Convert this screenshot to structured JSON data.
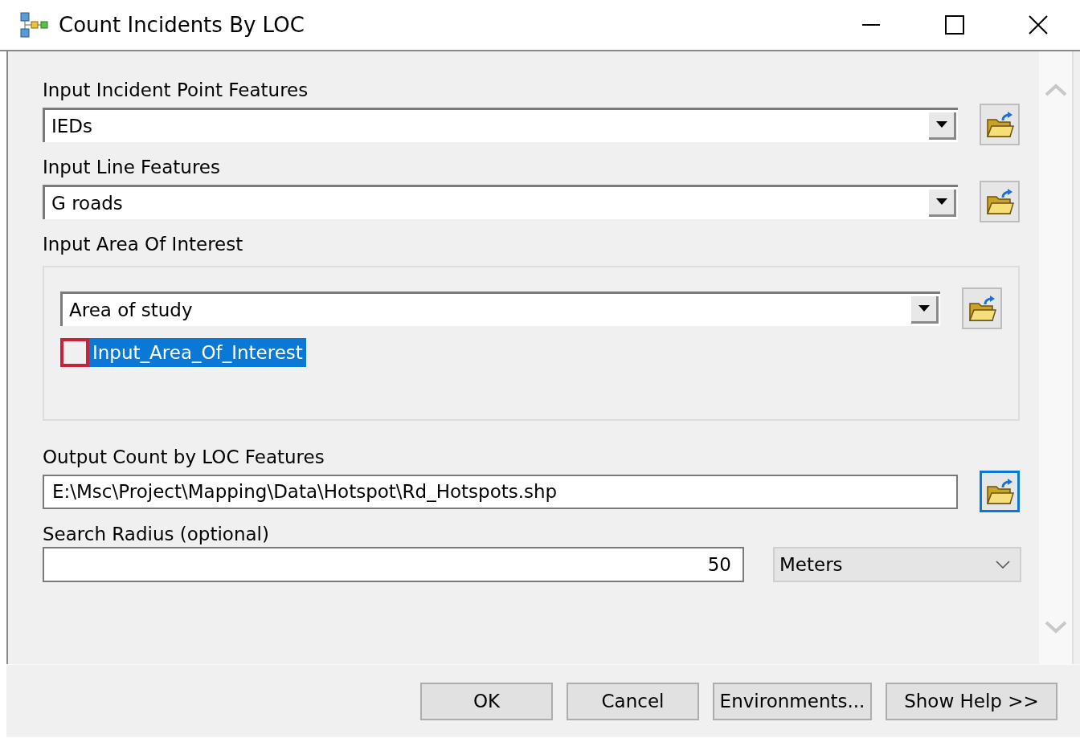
{
  "window": {
    "title": "Count Incidents By LOC"
  },
  "parameters": [
    {
      "kind": "combo",
      "label": "Input Incident Point Features",
      "value": "IEDs",
      "browse_focused": false
    },
    {
      "kind": "combo",
      "label": "Input Line Features",
      "value": "G roads",
      "browse_focused": false
    },
    {
      "kind": "group",
      "label": "Input Area Of Interest",
      "value": "Area of study",
      "browse_focused": false,
      "checkbox": {
        "label": "Input_Area_Of_Interest",
        "checked": false,
        "selected": true
      }
    },
    {
      "kind": "text",
      "label": "Output Count by LOC Features",
      "value": "E:\\Msc\\Project\\Mapping\\Data\\Hotspot\\Rd_Hotspots.shp",
      "browse_focused": true
    },
    {
      "kind": "linear",
      "label": "Search Radius (optional)",
      "value": "50",
      "unit": "Meters"
    }
  ],
  "buttons": [
    "OK",
    "Cancel",
    "Environments...",
    "Show Help >>"
  ]
}
